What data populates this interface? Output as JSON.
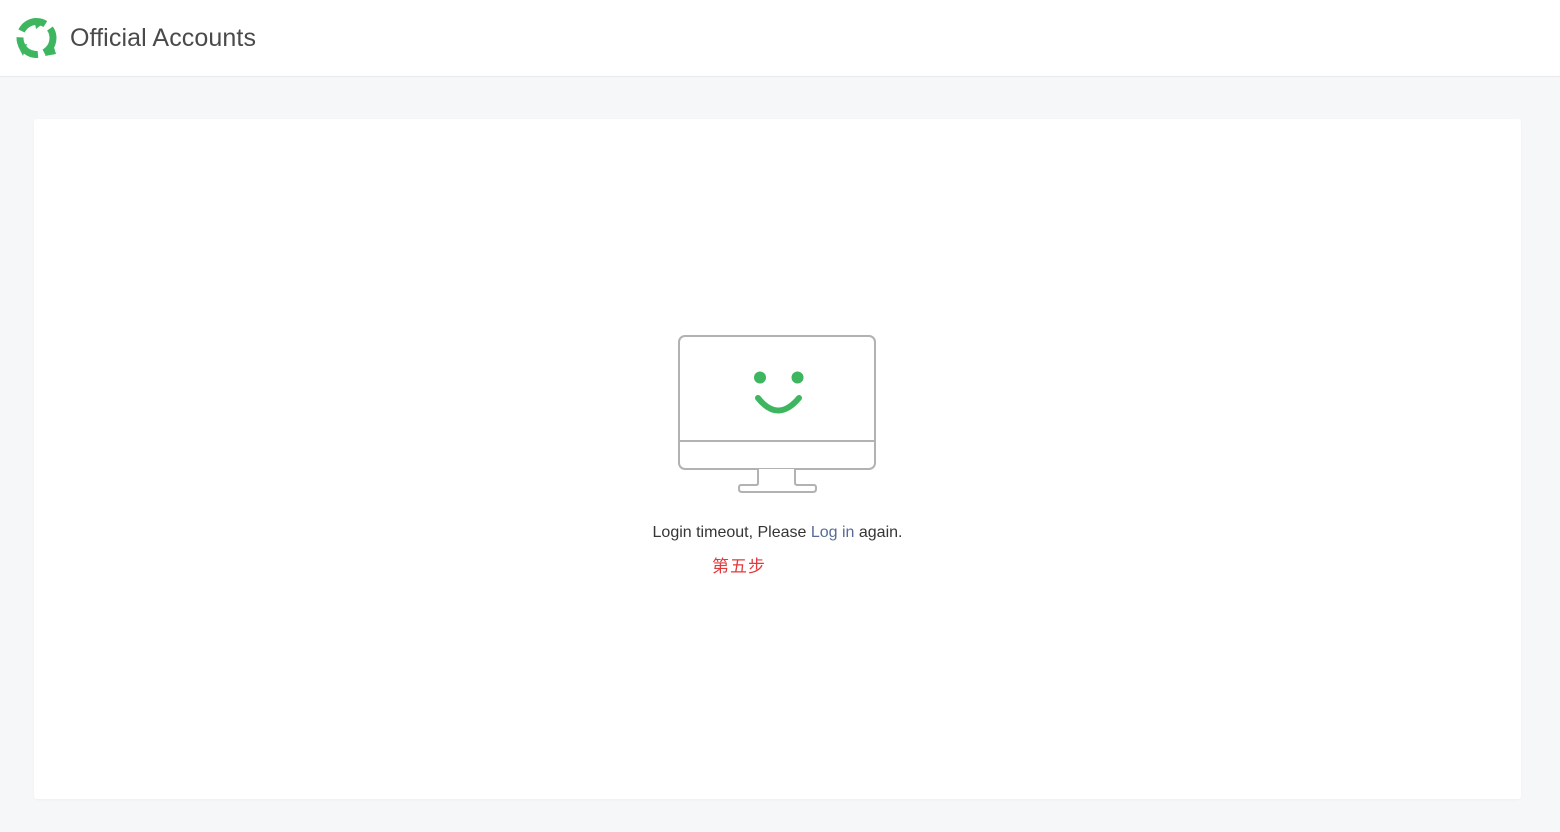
{
  "header": {
    "brand_title": "Official Accounts",
    "logo_icon": "wechat-official-accounts-logo-icon",
    "accent_color": "#3eb65f"
  },
  "main": {
    "illustration_icon": "smiling-monitor-icon",
    "message": {
      "prefix": "Login timeout, Please ",
      "link_label": "Log in",
      "suffix": " again."
    },
    "annotation": "第五步",
    "annotation_color": "#e4393c",
    "link_color": "#576b95"
  }
}
